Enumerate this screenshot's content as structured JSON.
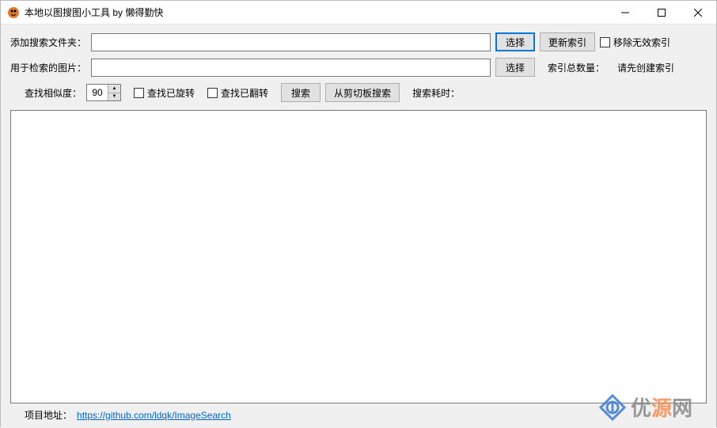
{
  "window": {
    "title": "本地以图搜图小工具 by 懒得勤快"
  },
  "row1": {
    "label": "添加搜索文件夹：",
    "folder_value": "",
    "select_btn": "选择",
    "update_index_btn": "更新索引",
    "remove_invalid_label": "移除无效索引"
  },
  "row2": {
    "label": "用于检索的图片：",
    "image_value": "",
    "select_btn": "选择",
    "index_count_label": "索引总数量：",
    "index_count_hint": "请先创建索引"
  },
  "row3": {
    "similarity_label": "查找相似度：",
    "similarity_value": "90",
    "search_rotated_label": "查找已旋转",
    "search_flipped_label": "查找已翻转",
    "search_btn": "搜索",
    "clipboard_btn": "从剪切板搜索",
    "time_label": "搜索耗时："
  },
  "footer": {
    "addr_label": "项目地址：",
    "url": "https://github.com/ldqk/ImageSearch"
  },
  "watermark": {
    "t1": "优",
    "t2": "源",
    "t3": "网"
  }
}
